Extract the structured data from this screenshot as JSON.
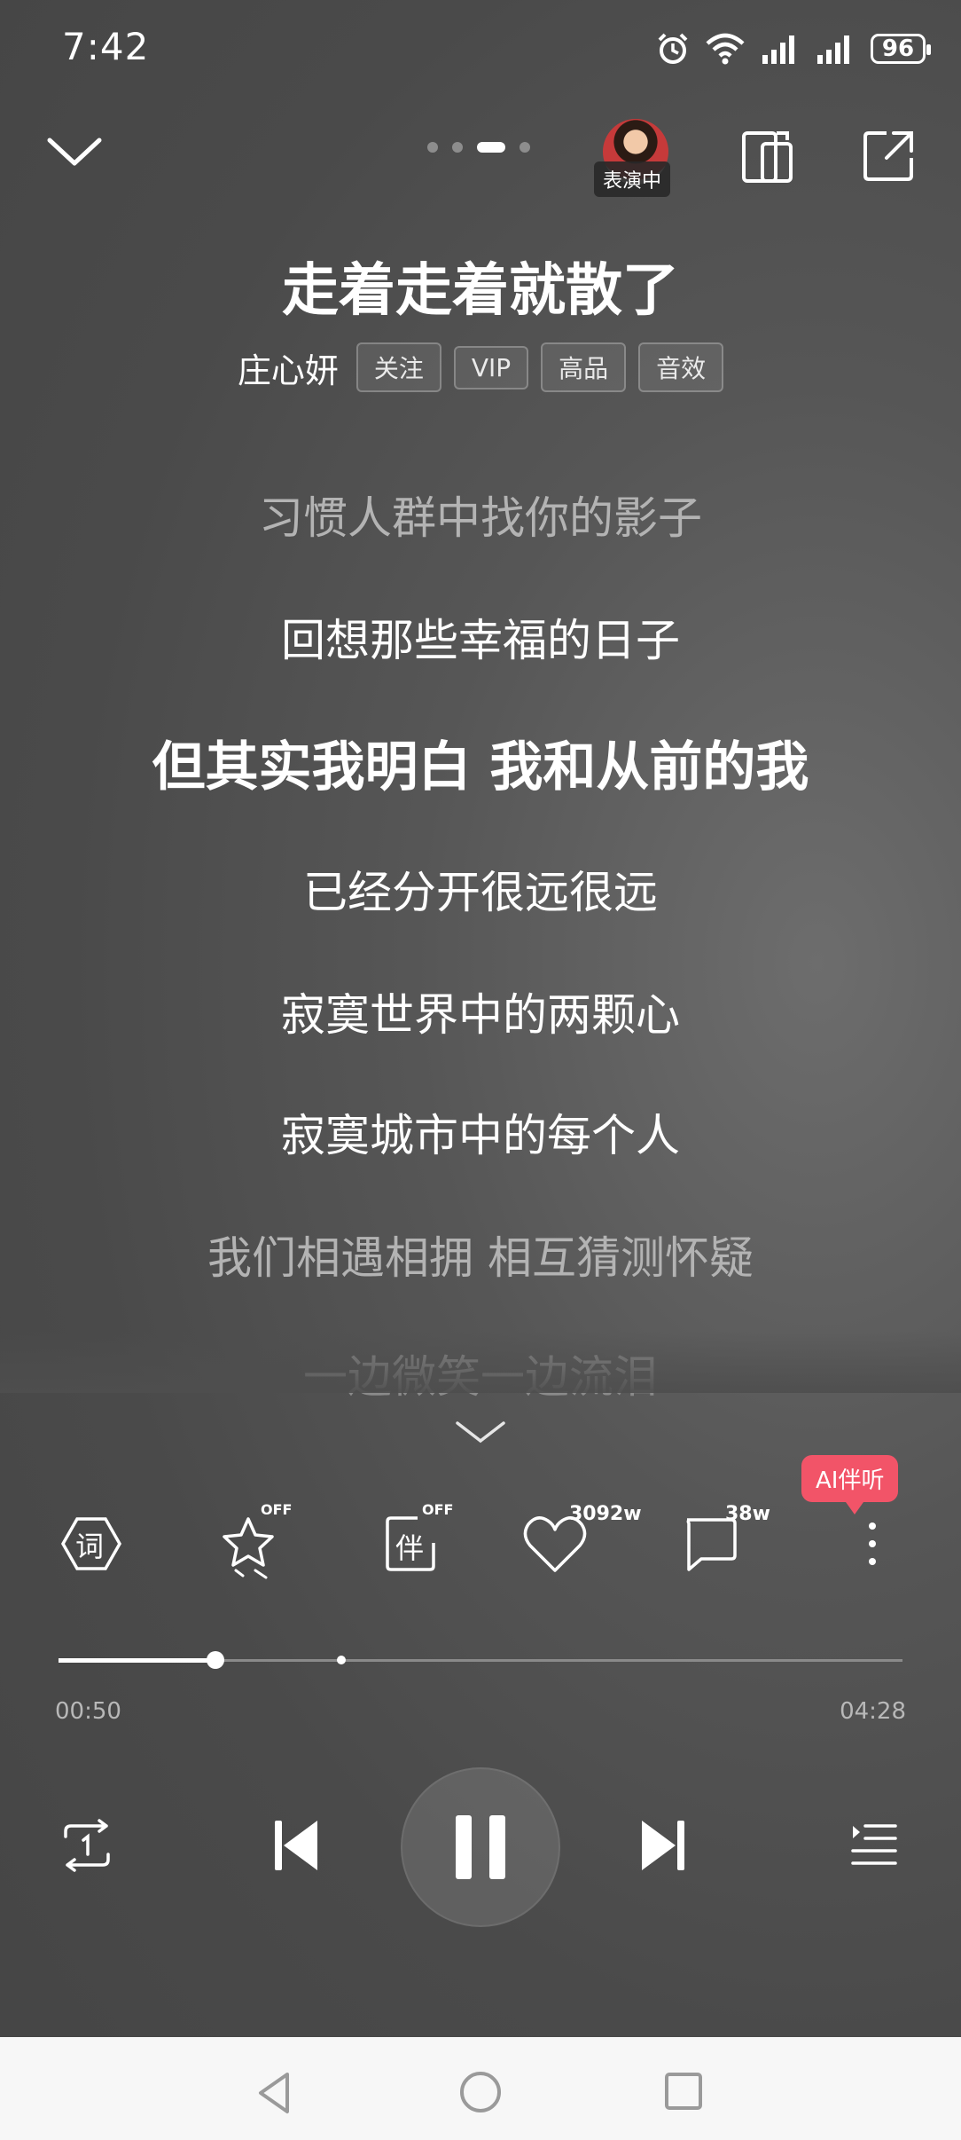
{
  "status_bar": {
    "time": "7:42",
    "battery": "96"
  },
  "song": {
    "title": "走着走着就散了",
    "artist": "庄心妍",
    "tags": [
      "关注",
      "VIP",
      "高品",
      "音效"
    ]
  },
  "performing_badge": "表演中",
  "lyrics": [
    "习惯人群中找你的影子",
    "回想那些幸福的日子",
    "但其实我明白 我和从前的我",
    "已经分开很远很远",
    "寂寞世界中的两颗心",
    "寂寞城市中的每个人",
    "我们相遇相拥 相互猜测怀疑",
    "一边微笑一边流泪"
  ],
  "actions": {
    "lyrics_icon_label": "词",
    "accompany_icon_label": "伴",
    "effect_off": "OFF",
    "accompany_off": "OFF",
    "likes_count": "3092w",
    "comments_count": "38w",
    "ai_bubble": "AI伴听"
  },
  "playback": {
    "elapsed": "00:50",
    "duration": "04:28",
    "progress": 0.186,
    "marker": 0.335
  }
}
